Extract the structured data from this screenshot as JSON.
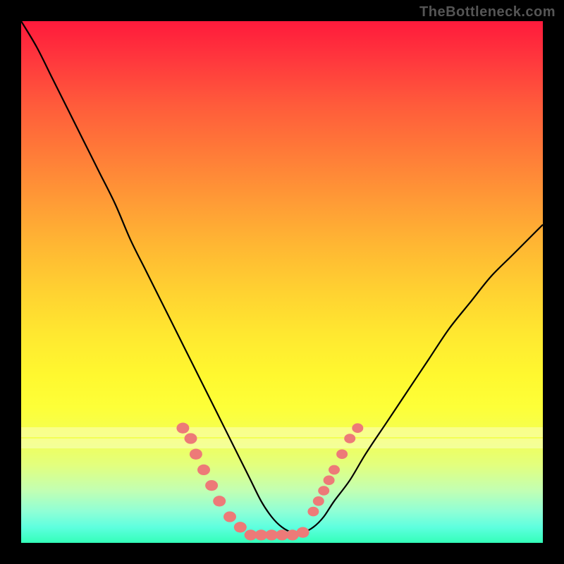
{
  "watermark_text": "TheBottleneck.com",
  "colors": {
    "curve_stroke": "#000000",
    "marker_fill": "#ed7a78",
    "marker_stroke": "#d85f5e",
    "frame_bg": "#000000"
  },
  "chart_data": {
    "type": "line",
    "title": "",
    "xlabel": "",
    "ylabel": "",
    "xlim": [
      0,
      100
    ],
    "ylim": [
      0,
      100
    ],
    "grid": false,
    "legend": false,
    "series": [
      {
        "name": "bottleneck-curve",
        "x": [
          0,
          3,
          6,
          9,
          12,
          15,
          18,
          21,
          24,
          27,
          30,
          33,
          36,
          38,
          40,
          42,
          44,
          46,
          48,
          50,
          52,
          54,
          56,
          58,
          60,
          63,
          66,
          70,
          74,
          78,
          82,
          86,
          90,
          94,
          98,
          100
        ],
        "y": [
          100,
          95,
          89,
          83,
          77,
          71,
          65,
          58,
          52,
          46,
          40,
          34,
          28,
          24,
          20,
          16,
          12,
          8,
          5,
          3,
          2,
          2,
          3,
          5,
          8,
          12,
          17,
          23,
          29,
          35,
          41,
          46,
          51,
          55,
          59,
          61
        ]
      }
    ],
    "markers_left": [
      {
        "x": 31,
        "y": 22
      },
      {
        "x": 32.5,
        "y": 20
      },
      {
        "x": 33.5,
        "y": 17
      },
      {
        "x": 35,
        "y": 14
      },
      {
        "x": 36.5,
        "y": 11
      },
      {
        "x": 38,
        "y": 8
      },
      {
        "x": 40,
        "y": 5
      },
      {
        "x": 42,
        "y": 3
      }
    ],
    "markers_bottom": [
      {
        "x": 44,
        "y": 1.5
      },
      {
        "x": 46,
        "y": 1.5
      },
      {
        "x": 48,
        "y": 1.5
      },
      {
        "x": 50,
        "y": 1.5
      },
      {
        "x": 52,
        "y": 1.5
      },
      {
        "x": 54,
        "y": 2
      }
    ],
    "markers_right": [
      {
        "x": 56,
        "y": 6
      },
      {
        "x": 57,
        "y": 8
      },
      {
        "x": 58,
        "y": 10
      },
      {
        "x": 59,
        "y": 12
      },
      {
        "x": 60,
        "y": 14
      },
      {
        "x": 61.5,
        "y": 17
      },
      {
        "x": 63,
        "y": 20
      },
      {
        "x": 64.5,
        "y": 22
      }
    ],
    "white_bands_y": [
      78,
      80
    ]
  }
}
